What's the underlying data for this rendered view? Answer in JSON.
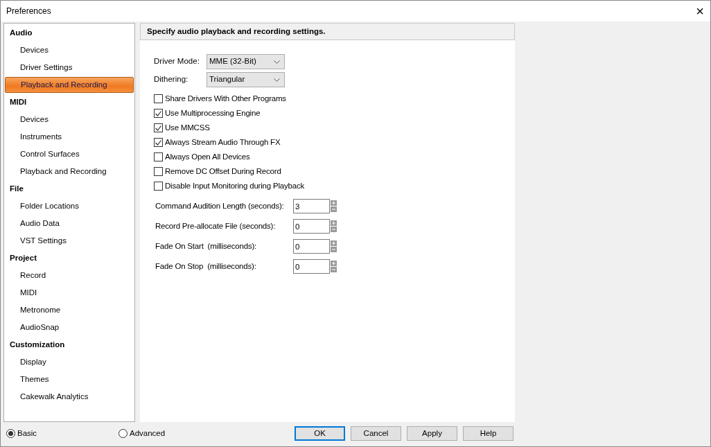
{
  "window": {
    "title": "Preferences",
    "close": "×"
  },
  "sidebar": {
    "items": [
      {
        "label": "Audio",
        "children": [
          {
            "label": "Devices",
            "selected": false
          },
          {
            "label": "Driver Settings",
            "selected": false
          },
          {
            "label": "Playback and Recording",
            "selected": true
          }
        ]
      },
      {
        "label": "MIDI",
        "children": [
          {
            "label": "Devices",
            "selected": false
          },
          {
            "label": "Instruments",
            "selected": false
          },
          {
            "label": "Control Surfaces",
            "selected": false
          },
          {
            "label": "Playback and Recording",
            "selected": false
          }
        ]
      },
      {
        "label": "File",
        "children": [
          {
            "label": "Folder Locations",
            "selected": false
          },
          {
            "label": "Audio Data",
            "selected": false
          },
          {
            "label": "VST Settings",
            "selected": false
          }
        ]
      },
      {
        "label": "Project",
        "children": [
          {
            "label": "Record",
            "selected": false
          },
          {
            "label": "MIDI",
            "selected": false
          },
          {
            "label": "Metronome",
            "selected": false
          },
          {
            "label": "AudioSnap",
            "selected": false
          }
        ]
      },
      {
        "label": "Customization",
        "children": [
          {
            "label": "Display",
            "selected": false
          },
          {
            "label": "Themes",
            "selected": false
          },
          {
            "label": "Cakewalk Analytics",
            "selected": false
          }
        ]
      }
    ]
  },
  "panel": {
    "heading": "Specify audio playback and recording settings.",
    "dropdowns": [
      {
        "label": "Driver Mode:",
        "value": "MME (32-Bit)"
      },
      {
        "label": "Dithering:",
        "value": "Triangular"
      }
    ],
    "checkboxes": [
      {
        "label": "Share Drivers With Other Programs",
        "checked": false
      },
      {
        "label": "Use Multiprocessing Engine",
        "checked": true
      },
      {
        "label": "Use MMCSS",
        "checked": true
      },
      {
        "label": "Always Stream Audio Through FX",
        "checked": true
      },
      {
        "label": "Always Open All Devices",
        "checked": false
      },
      {
        "label": "Remove DC Offset During Record",
        "checked": false
      },
      {
        "label": "Disable Input Monitoring during Playback",
        "checked": false
      }
    ],
    "spinners": [
      {
        "label": "Command Audition Length (seconds):",
        "value": "3"
      },
      {
        "label": "Record Pre-allocate File (seconds):",
        "value": "0"
      },
      {
        "label": "Fade On Start  (milliseconds):",
        "value": "0"
      },
      {
        "label": "Fade On Stop  (milliseconds):",
        "value": "0"
      }
    ]
  },
  "mode": [
    {
      "label": "Basic",
      "selected": true
    },
    {
      "label": "Advanced",
      "selected": false
    }
  ],
  "buttons": [
    {
      "label": "OK",
      "default": true
    },
    {
      "label": "Cancel",
      "default": false
    },
    {
      "label": "Apply",
      "default": false
    },
    {
      "label": "Help",
      "default": false
    }
  ]
}
